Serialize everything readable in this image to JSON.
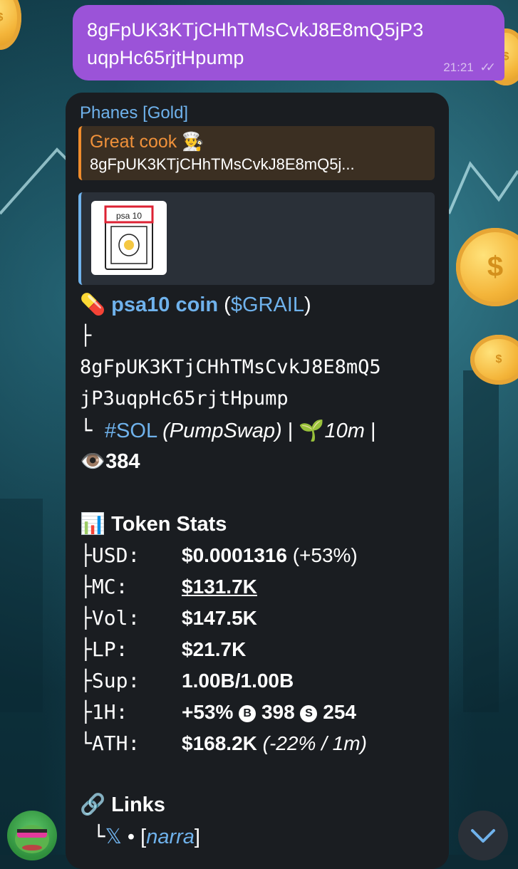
{
  "sent_message": {
    "text_line1": "8gFpUK3KTjCHhTMsCvkJ8E8mQ5jP3",
    "text_line2": "uqpHc65rjtHpump",
    "time": "21:21",
    "ticks": "✓✓"
  },
  "bot_message": {
    "sender": "Phanes [Gold]",
    "reply": {
      "title": "Great cook 👨‍🍳",
      "text": "8gFpUK3KTjCHhTMsCvkJ8E8mQ5j..."
    },
    "preview_image": {
      "label": "psa 10"
    },
    "token": {
      "emoji": "💊",
      "name": "psa10 coin",
      "symbol_open": "(",
      "symbol": "$GRAIL",
      "symbol_close": ")",
      "branch": "├",
      "address_line1": "8gFpUK3KTjCHhTMsCvkJ8E8mQ5",
      "address_line2": "jP3uqpHc65rjtHpump",
      "chain_prefix": "└ ",
      "chain": "#SOL",
      "dex": "(PumpSwap)",
      "separator": " | ",
      "age_emoji": "🌱",
      "age": "10m",
      "views_emoji": "👁️",
      "views": "384"
    },
    "stats": {
      "heading_emoji": "📊",
      "heading": "Token Stats",
      "rows": [
        {
          "prefix": "├",
          "key": "USD:",
          "value": "$0.0001316",
          "extra": " (+53%)"
        },
        {
          "prefix": "├",
          "key": "MC:",
          "value": "$131.7K"
        },
        {
          "prefix": "├",
          "key": "Vol:",
          "value": "$147.5K"
        },
        {
          "prefix": "├",
          "key": "LP:",
          "value": "$21.7K"
        },
        {
          "prefix": "├",
          "key": "Sup:",
          "value": "1.00B/1.00B"
        },
        {
          "prefix": "├",
          "key": "1H:",
          "value": "+53%",
          "b_badge": "B",
          "buys": "398",
          "s_badge": "S",
          "sells": "254"
        },
        {
          "prefix": "└",
          "key": "ATH:",
          "value": "$168.2K",
          "extra": " (-22% / 1m)"
        }
      ]
    },
    "links": {
      "heading_emoji": "🔗",
      "heading": "Links",
      "prefix": "└",
      "x_label": "𝕏",
      "dot": " • ",
      "bracket_open": "[",
      "narra": "narra",
      "bracket_close": "]"
    }
  },
  "colors": {
    "sent_bubble": "#9b53d8",
    "card": "#1a1d21",
    "link": "#6fb2ec",
    "reply_accent": "#f08c2c"
  },
  "icons": [
    "double-check-icon",
    "chevron-down-icon"
  ]
}
